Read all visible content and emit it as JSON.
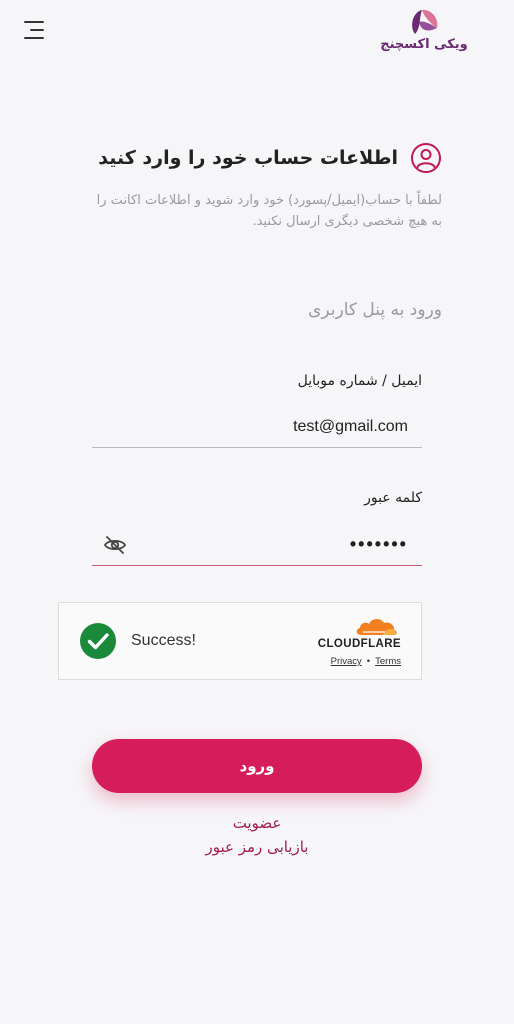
{
  "header": {
    "logo_text": "ویکی اکسچنج",
    "icons": {
      "menu": "menu-icon",
      "logo": "logo-mark-icon"
    },
    "colors": {
      "logo_primary": "#6a2a70",
      "logo_accent": "#d95b86"
    }
  },
  "info": {
    "title": "اطلاعات حساب خود را وارد کنید",
    "description_line1": "لطفاً با حساب(ایمیل/پسورد) خود وارد شوید و اطلاعات اکانت را",
    "description_line2": "به هیچ شخصی دیگری ارسال نکنید.",
    "icon": "user-circle-icon",
    "icon_color": "#c2185b"
  },
  "form": {
    "section_title": "ورود به پنل کاربری",
    "email": {
      "label": "ایمیل / شماره موبایل",
      "value": "test@gmail.com"
    },
    "password": {
      "label": "کلمه عبور",
      "value": "1234567",
      "toggle_icon": "eye-off-icon"
    }
  },
  "captcha": {
    "status": "Success!",
    "brand": "CLOUDFLARE",
    "privacy_link": "Privacy",
    "separator": "•",
    "terms_link": "Terms",
    "icons": {
      "check": "check-circle-icon",
      "brand": "cloudflare-cloud-icon"
    },
    "colors": {
      "check": "#1a8a3a",
      "cloud": "#f38020"
    }
  },
  "actions": {
    "submit_label": "ورود",
    "register_link": "عضویت",
    "recover_link": "بازیابی رمز عبور",
    "colors": {
      "primary": "#d61d5b",
      "link": "#a0204f"
    }
  }
}
